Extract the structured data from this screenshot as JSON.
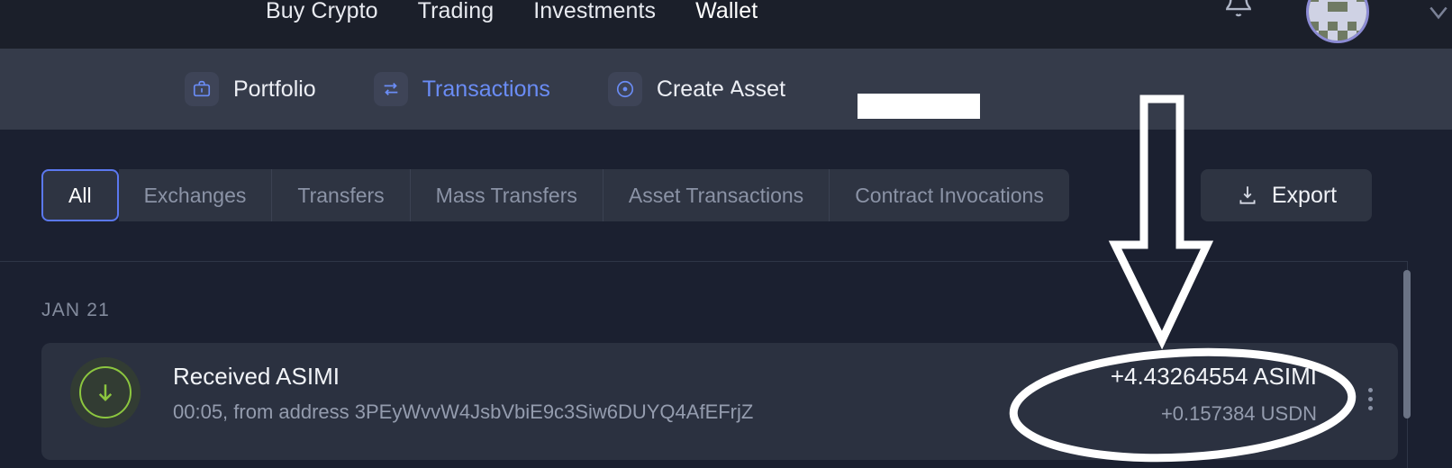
{
  "header": {
    "nav": [
      {
        "label": "Buy Crypto",
        "active": false
      },
      {
        "label": "Trading",
        "active": false
      },
      {
        "label": "Investments",
        "active": false
      },
      {
        "label": "Wallet",
        "active": true
      }
    ],
    "bell_icon": "bell-icon",
    "bell_badge": true,
    "avatar_icon": "avatar-identicon",
    "colors": {
      "background": "#1b1f2a",
      "badge": "#4a7df0",
      "avatar_ring": "#8c8bd4"
    }
  },
  "subnav": {
    "items": [
      {
        "label": "Portfolio",
        "icon": "briefcase-icon",
        "active": false
      },
      {
        "label": "Transactions",
        "icon": "swap-arrows-icon",
        "active": true
      },
      {
        "label": "Create Asset",
        "icon": "circle-dot-icon",
        "active": false
      }
    ],
    "redacted_value": "",
    "colors": {
      "background": "#353b4a",
      "active_text": "#6a8cf5"
    }
  },
  "filters": {
    "segments": [
      {
        "label": "All",
        "active": true
      },
      {
        "label": "Exchanges",
        "active": false
      },
      {
        "label": "Transfers",
        "active": false
      },
      {
        "label": "Mass Transfers",
        "active": false
      },
      {
        "label": "Asset Transactions",
        "active": false
      },
      {
        "label": "Contract Invocations",
        "active": false
      }
    ],
    "export": {
      "label": "Export",
      "icon": "download-icon"
    },
    "colors": {
      "segment_bg": "#2e3442",
      "active_border": "#5b78ef",
      "inactive_text": "#8b93a6"
    }
  },
  "transactions": {
    "date_group": "JAN 21",
    "items": [
      {
        "icon": "arrow-down-circle-icon",
        "title": "Received ASIMI",
        "subtitle": "00:05, from address 3PEyWvvW4JsbVbiE9c3Siw6DUYQ4AfEFrjZ",
        "amount": "+4.43264554 ASIMI",
        "amount_secondary": "+0.157384 USDN",
        "menu_icon": "kebab-menu-icon"
      }
    ],
    "colors": {
      "card_bg": "#2b3140",
      "received_accent": "#8cc63f",
      "muted_text": "#949cae"
    }
  },
  "annotations": {
    "arrow": {
      "name": "highlight-arrow-down",
      "color": "#ffffff"
    },
    "ellipse": {
      "name": "highlight-ellipse",
      "color": "#ffffff"
    }
  }
}
